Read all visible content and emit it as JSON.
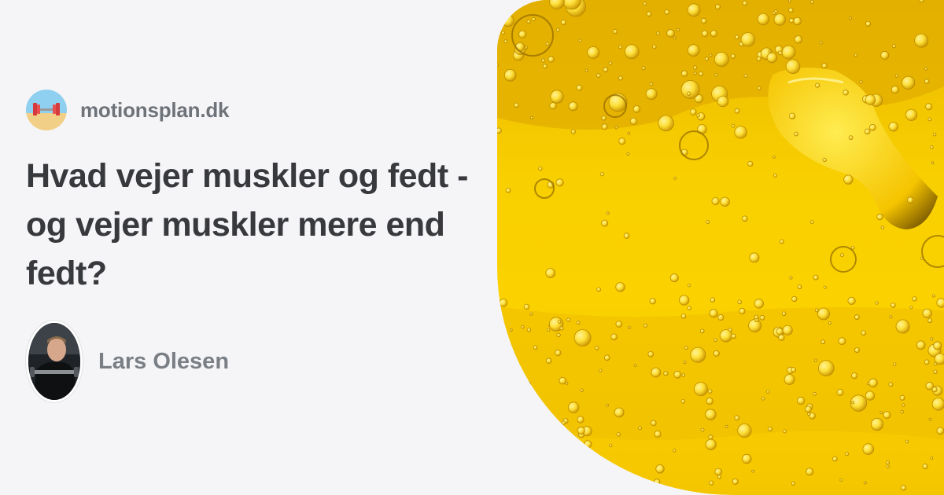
{
  "site": {
    "name": "motionsplan.dk",
    "logo_icon": "dumbbell-icon"
  },
  "article": {
    "title": "Hvad vejer muskler og fedt - og vejer muskler mere end fedt?"
  },
  "author": {
    "name": "Lars Olesen",
    "avatar_icon": "person-avatar-icon"
  },
  "hero": {
    "icon": "oil-bubbles-image",
    "color_main": "#f8cf00",
    "color_dark": "#d4a000",
    "color_light": "#ffe84a"
  }
}
